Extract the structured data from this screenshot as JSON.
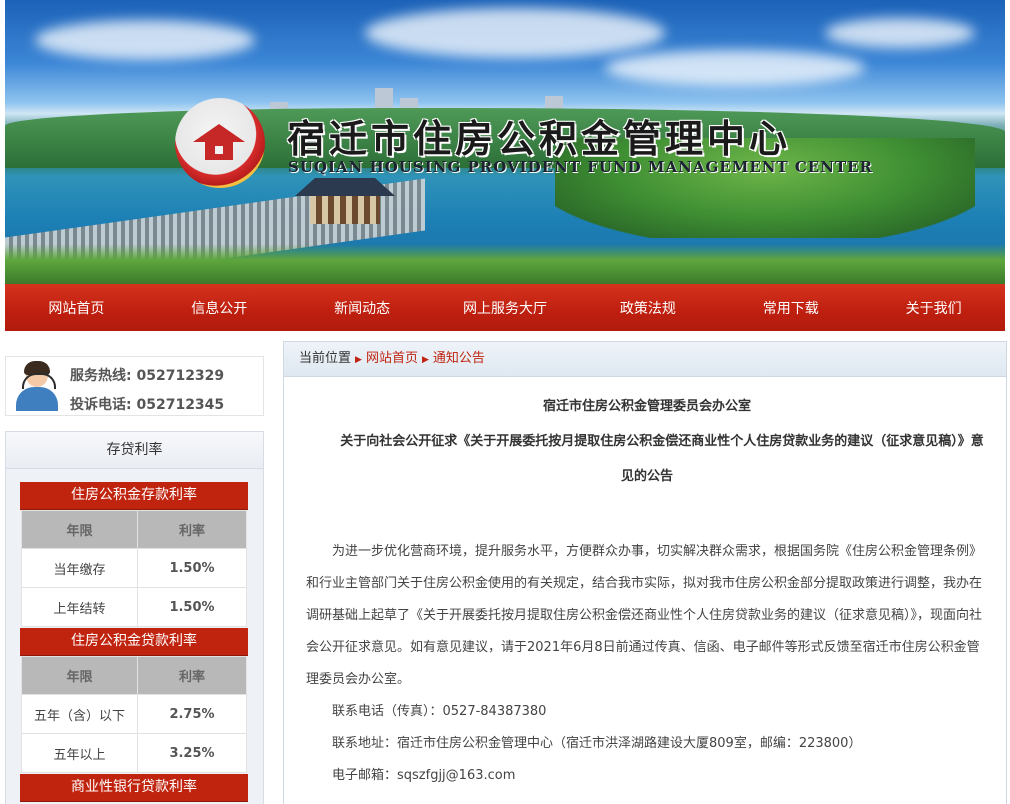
{
  "header": {
    "title": "宿迁市住房公积金管理中心",
    "subtitle": "SUQIAN HOUSING PROVIDENT FUND MANAGEMENT CENTER"
  },
  "nav": {
    "items": [
      "网站首页",
      "信息公开",
      "新闻动态",
      "网上服务大厅",
      "政策法规",
      "常用下载",
      "关于我们"
    ]
  },
  "sidebar": {
    "hotline": {
      "service_label": "服务热线:",
      "service_number": "052712329",
      "complaint_label": "投诉电话:",
      "complaint_number": "052712345"
    },
    "rates": {
      "title": "存贷利率",
      "deposit": {
        "heading": "住房公积金存款利率",
        "col_term": "年限",
        "col_rate": "利率",
        "rows": [
          {
            "term": "当年缴存",
            "rate": "1.50%"
          },
          {
            "term": "上年结转",
            "rate": "1.50%"
          }
        ]
      },
      "loan": {
        "heading": "住房公积金贷款利率",
        "col_term": "年限",
        "col_rate": "利率",
        "rows": [
          {
            "term": "五年（含）以下",
            "rate": "2.75%"
          },
          {
            "term": "五年以上",
            "rate": "3.25%"
          }
        ]
      },
      "commercial": {
        "heading": "商业性银行贷款利率"
      }
    }
  },
  "breadcrumb": {
    "current_label": "当前位置",
    "home": "网站首页",
    "section": "通知公告"
  },
  "article": {
    "org": "宿迁市住房公积金管理委员会办公室",
    "title": "关于向社会公开征求《关于开展委托按月提取住房公积金偿还商业性个人住房贷款业务的建议（征求意见稿）》意见的公告",
    "body": "为进一步优化营商环境，提升服务水平，方便群众办事，切实解决群众需求，根据国务院《住房公积金管理条例》和行业主管部门关于住房公积金使用的有关规定，结合我市实际，拟对我市住房公积金部分提取政策进行调整，我办在调研基础上起草了《关于开展委托按月提取住房公积金偿还商业性个人住房贷款业务的建议（征求意见稿）》，现面向社会公开征求意见。如有意见建议，请于2021年6月8日前通过传真、信函、电子邮件等形式反馈至宿迁市住房公积金管理委员会办公室。",
    "contact_phone": "联系电话（传真）：0527-84387380",
    "contact_address": "联系地址：宿迁市住房公积金管理中心（宿迁市洪泽湖路建设大厦809室，邮编：223800）",
    "contact_email": "电子邮箱：sqszfgjj@163.com"
  }
}
